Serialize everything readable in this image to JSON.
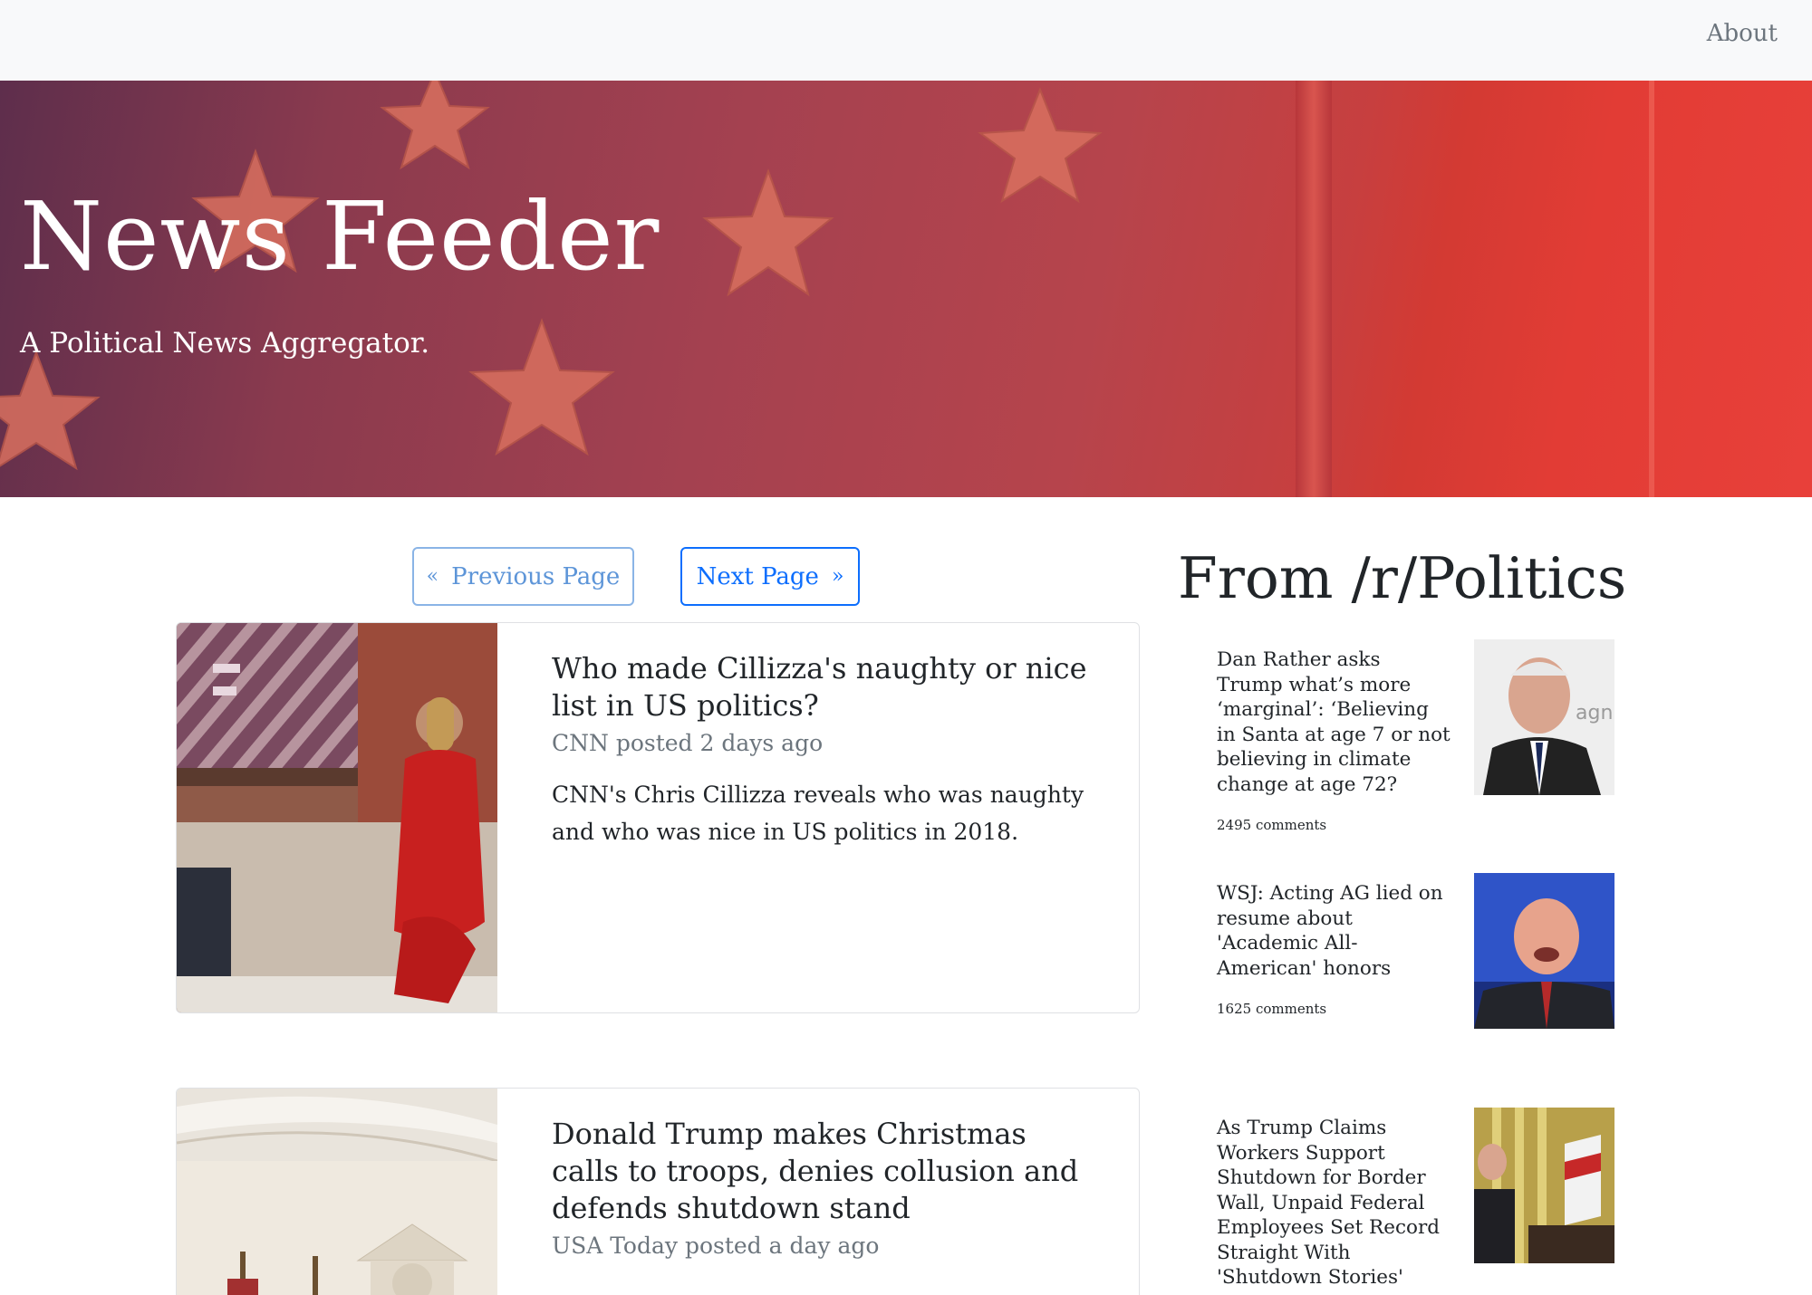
{
  "nav": {
    "about_label": "About"
  },
  "hero": {
    "title": "News Feeder",
    "subtitle": "A Political News Aggregator."
  },
  "pager": {
    "prev_label": "Previous Page",
    "next_label": "Next Page"
  },
  "articles": [
    {
      "headline": "Who made Cillizza's naughty or nice list in US politics?",
      "meta": "CNN posted 2 days ago",
      "description": "CNN's Chris Cillizza reveals who was naughty and who was nice in US politics in 2018."
    },
    {
      "headline": "Donald Trump makes Christmas calls to troops, denies collusion and defends shutdown stand",
      "meta": "USA Today posted a day ago",
      "description": ""
    }
  ],
  "sidebar": {
    "title": "From /r/Politics",
    "posts": [
      {
        "title": "Dan Rather asks Trump what’s more ‘marginal’: ‘Believing in Santa at age 7 or not believing in climate change at age 72?",
        "comments": "2495 comments"
      },
      {
        "title": "WSJ: Acting AG lied on resume about 'Academic All-American' honors",
        "comments": "1625 comments"
      },
      {
        "title": "As Trump Claims Workers Support Shutdown for Border Wall, Unpaid Federal Employees Set Record Straight With 'Shutdown Stories'",
        "comments": ""
      }
    ]
  }
}
